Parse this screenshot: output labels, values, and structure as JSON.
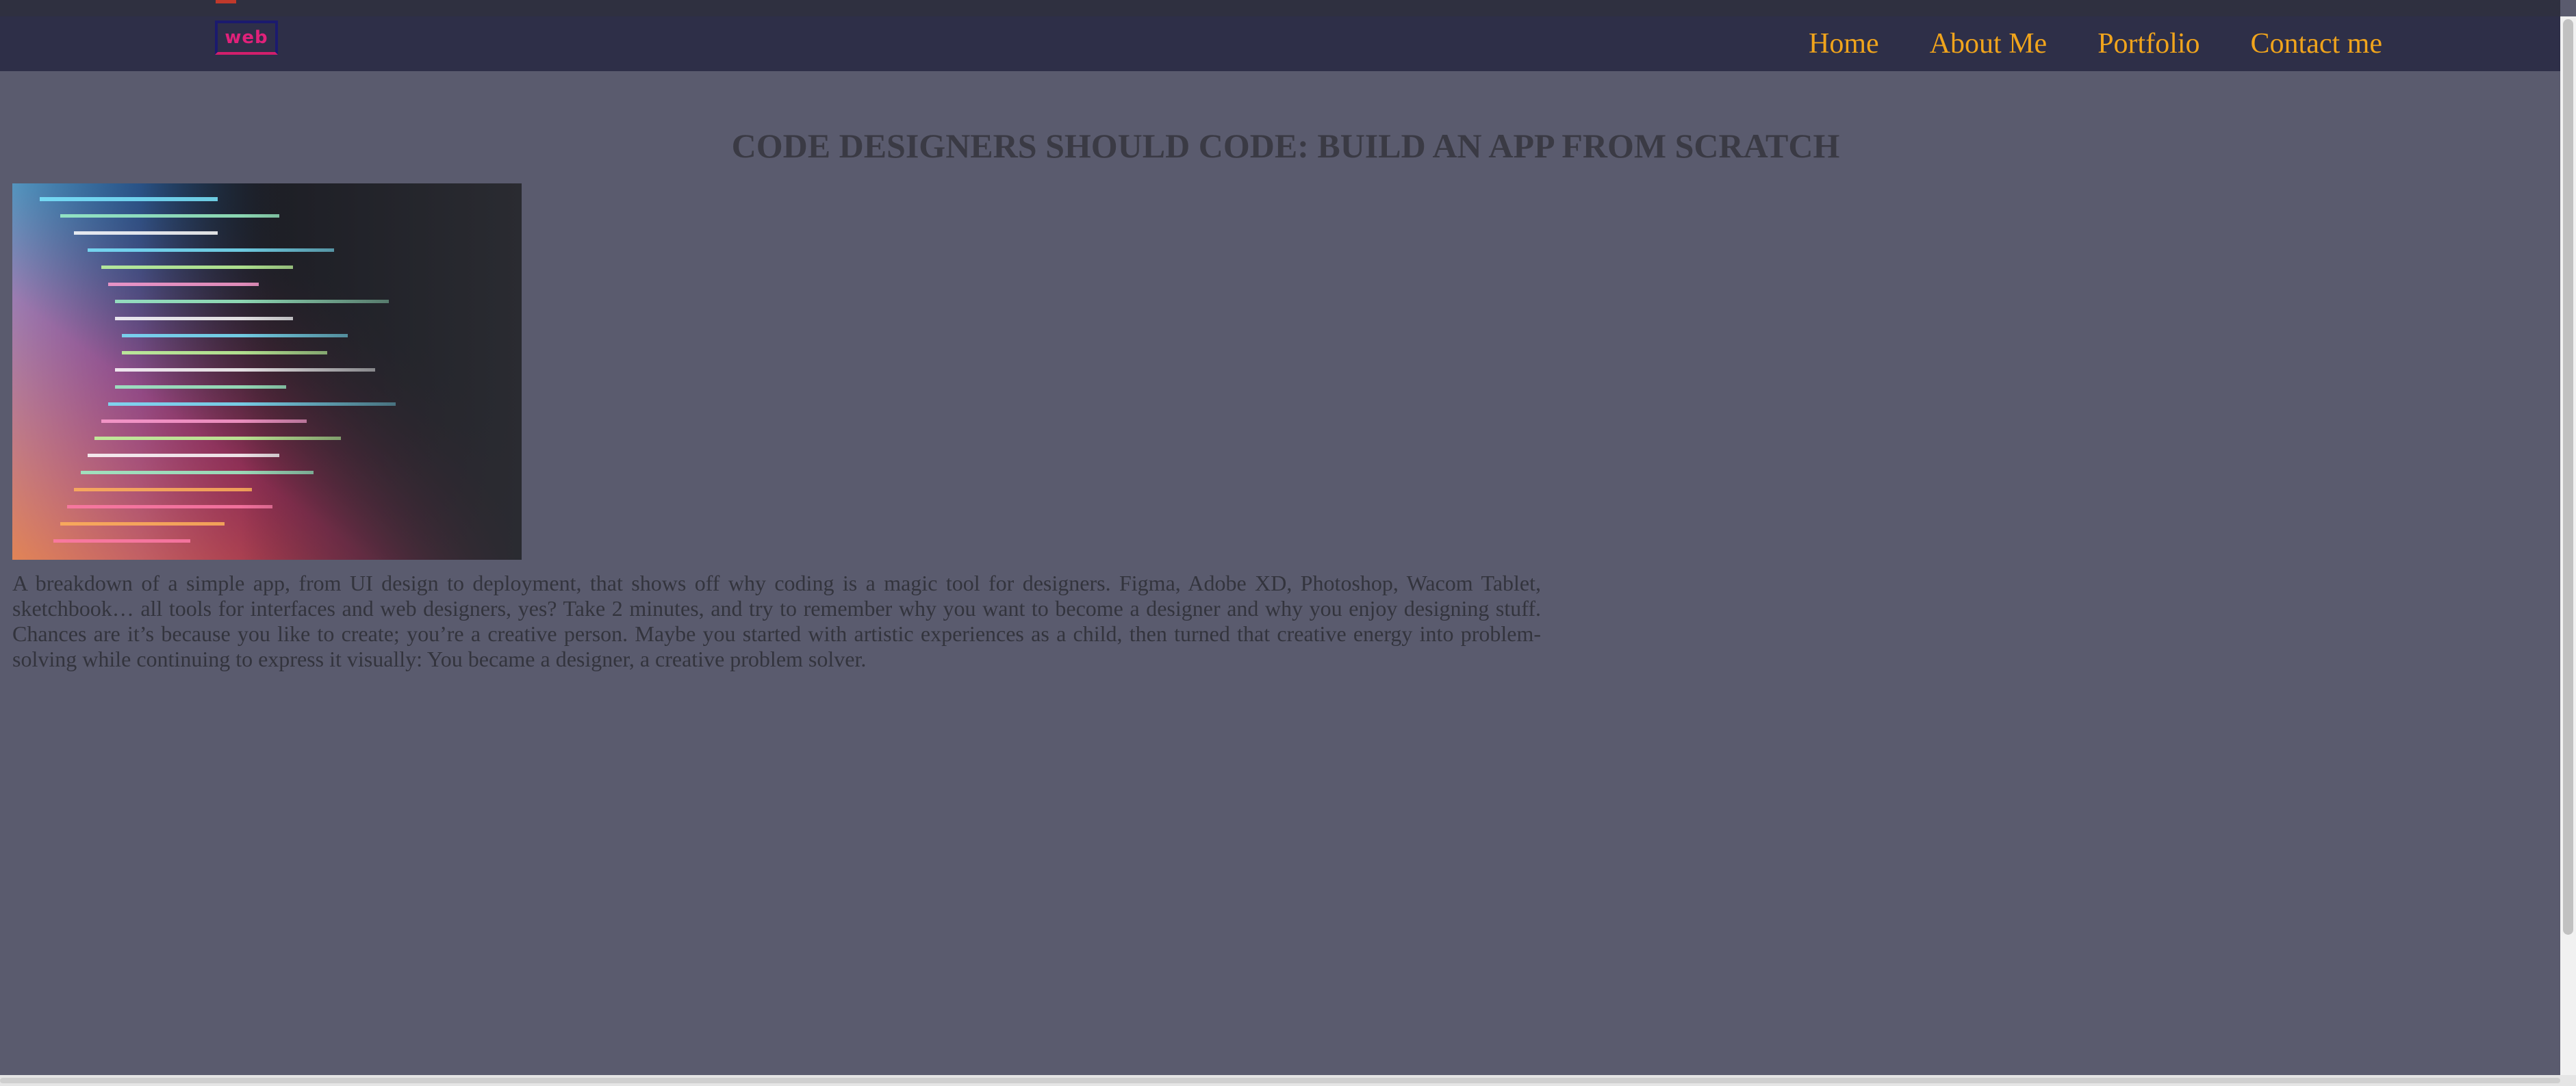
{
  "logo": {
    "text": "web"
  },
  "nav": {
    "items": [
      {
        "label": "Home"
      },
      {
        "label": "About Me"
      },
      {
        "label": "Portfolio"
      },
      {
        "label": "Contact me"
      }
    ]
  },
  "article": {
    "title": "CODE DESIGNERS SHOULD CODE: BUILD AN APP FROM SCRATCH",
    "body": "A breakdown of a simple app, from UI design to deployment, that shows off why coding is a magic tool for designers. Figma, Adobe XD, Photoshop, Wacom Tablet, sketchbook… all tools for interfaces and web designers, yes? Take 2 minutes, and try to remember why you want to become a designer and why you enjoy designing stuff. Chances are it’s because you like to create; you’re a creative person. Maybe you started with artistic experiences as a child, then turned that creative energy into problem-solving while continuing to express it visually: You became a designer, a creative problem solver."
  },
  "colors": {
    "page_bg": "#5a5b6e",
    "navbar_bg": "#2e2f48",
    "nav_link": "#f0a41c",
    "logo_text": "#e0217a",
    "title_text": "#3a3a44"
  }
}
